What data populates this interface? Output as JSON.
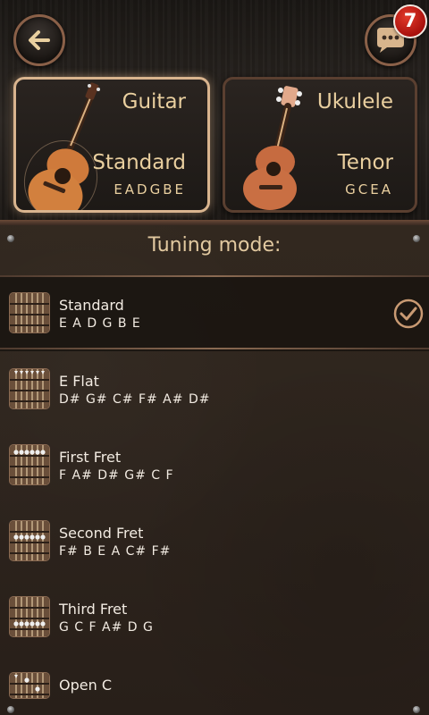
{
  "header": {
    "back_icon": "back-arrow-icon",
    "chat_icon": "chat-bubble-icon",
    "notification_count": "7"
  },
  "instruments": [
    {
      "title": "Guitar",
      "tuning": "Standard",
      "notes": "EADGBE",
      "selected": true
    },
    {
      "title": "Ukulele",
      "tuning": "Tenor",
      "notes": "GCEA",
      "selected": false
    }
  ],
  "tuning_mode": {
    "heading": "Tuning mode:",
    "items": [
      {
        "name": "Standard",
        "notes": "E A D G B E",
        "selected": true
      },
      {
        "name": "E Flat",
        "notes": "D# G# C# F# A# D#",
        "selected": false
      },
      {
        "name": "First Fret",
        "notes": "F A# D# G# C F",
        "selected": false
      },
      {
        "name": "Second Fret",
        "notes": "F# B E A C# F#",
        "selected": false
      },
      {
        "name": "Third Fret",
        "notes": "G C F A# D G",
        "selected": false
      },
      {
        "name": "Open C",
        "notes": "",
        "selected": false
      }
    ]
  },
  "colors": {
    "accent": "#d9b48e",
    "badge": "#c8191a"
  }
}
